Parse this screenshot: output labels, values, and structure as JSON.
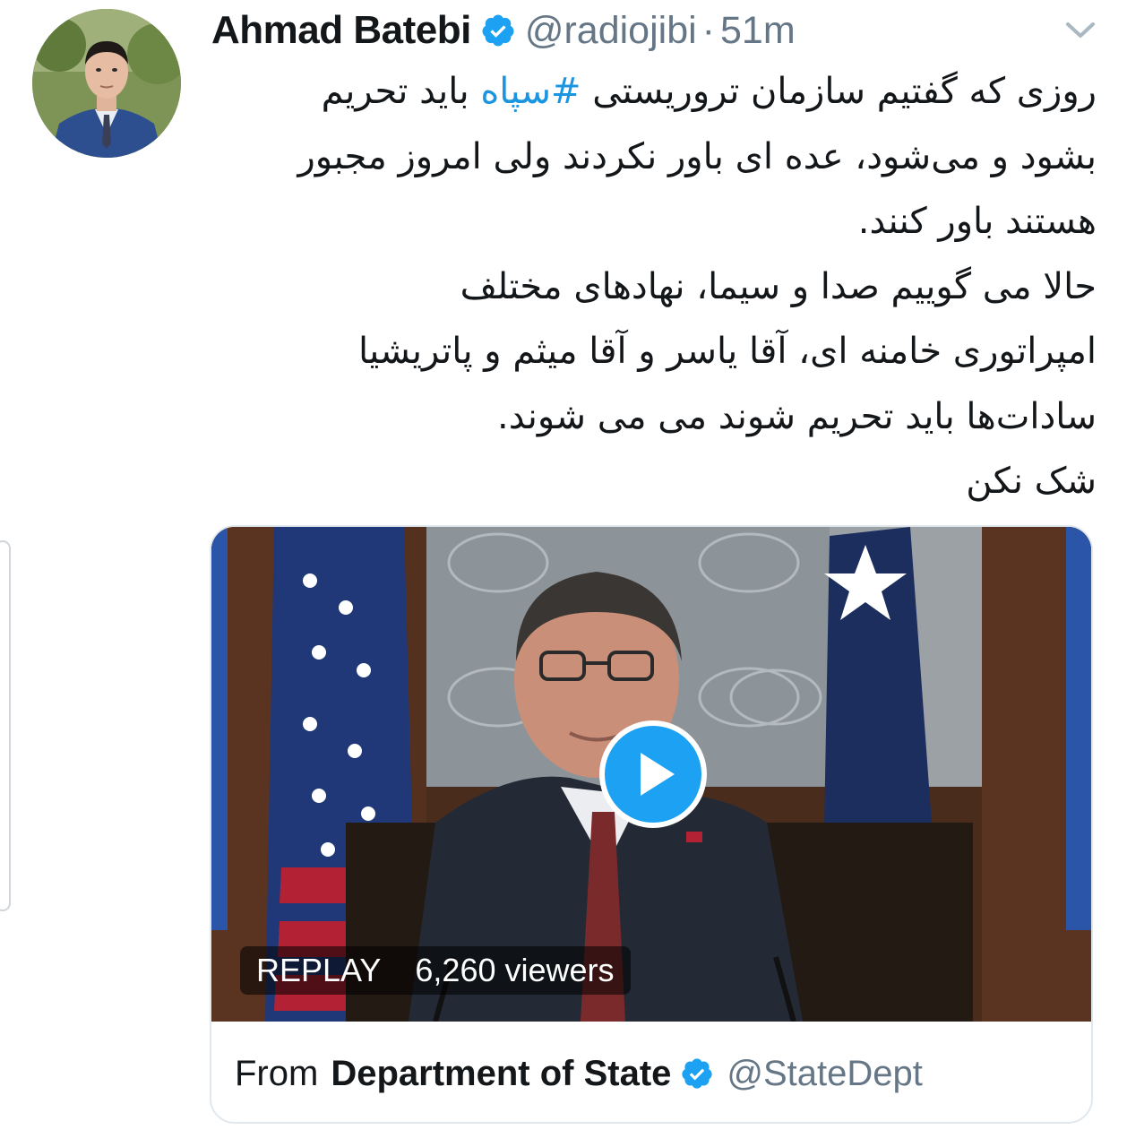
{
  "author": {
    "name": "Ahmad Batebi",
    "handle": "@radiojibi",
    "separator": "·",
    "time": "51m"
  },
  "tweet": {
    "lines": [
      "روزی که گفتیم سازمان تروریستی #سپاه باید تحریم",
      "بشود و می‌شود، عده ای باور نکردند ولی امروز مجبور",
      "هستند باور کنند.",
      "حالا می گوییم صدا و سیما، نهادهای مختلف",
      "امپراتوری خامنه ای، آقا یاسر و آقا میثم و پاتریشیا",
      "سادات‌ها باید تحریم شوند می می شوند.",
      "شک نکن"
    ],
    "line1_before": "روزی که گفتیم سازمان تروریستی ",
    "line1_hashtag": "#سپاه",
    "line1_after": " باید تحریم"
  },
  "media": {
    "replay_label": "REPLAY",
    "viewers": "6,260 viewers",
    "from_label": "From",
    "source_name": "Department of State",
    "source_handle": "@StateDept"
  },
  "icons": {
    "verified": "verified-badge-icon",
    "caret": "chevron-down-icon",
    "play": "play-icon"
  },
  "colors": {
    "link_blue": "#1b95e0",
    "verified_blue": "#1da1f2",
    "secondary_text": "#657786",
    "primary_text": "#14171a"
  }
}
